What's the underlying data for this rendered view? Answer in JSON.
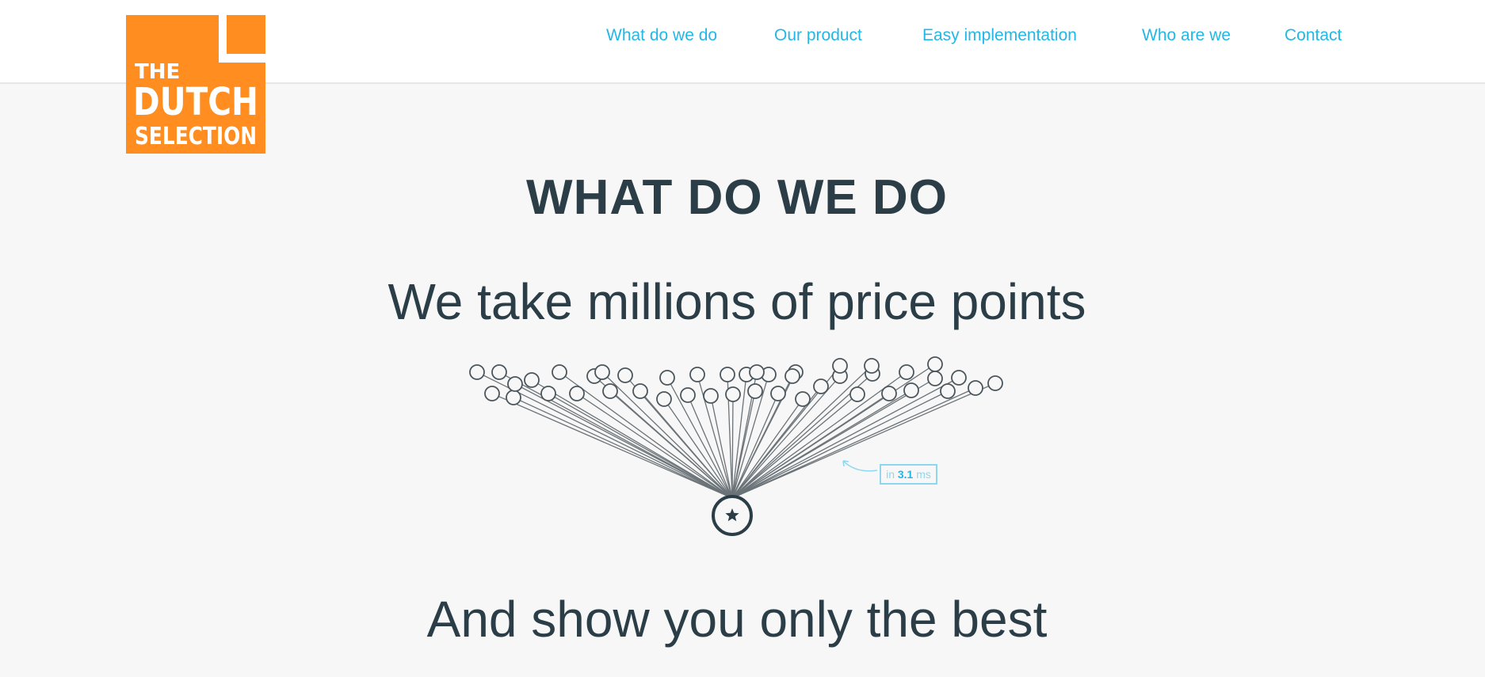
{
  "brand": {
    "line1": "THE",
    "line2": "DUTCH",
    "line3": "SELECTION",
    "color": "#ff8d1f"
  },
  "nav": {
    "items": [
      {
        "label": "What do we do"
      },
      {
        "label": "Our product"
      },
      {
        "label": "Easy implementation"
      },
      {
        "label": "Who are we"
      },
      {
        "label": "Contact"
      }
    ],
    "color": "#22b7e6"
  },
  "section": {
    "title": "WHAT DO WE DO"
  },
  "headline_top": "We take millions of price points",
  "headline_bottom": "And show you only the best",
  "timing": {
    "prefix": "in",
    "value": "3.1",
    "unit": "ms"
  },
  "graph": {
    "hub_icon": "star-icon",
    "node_icon": "circle-icon",
    "node_count": 44
  }
}
